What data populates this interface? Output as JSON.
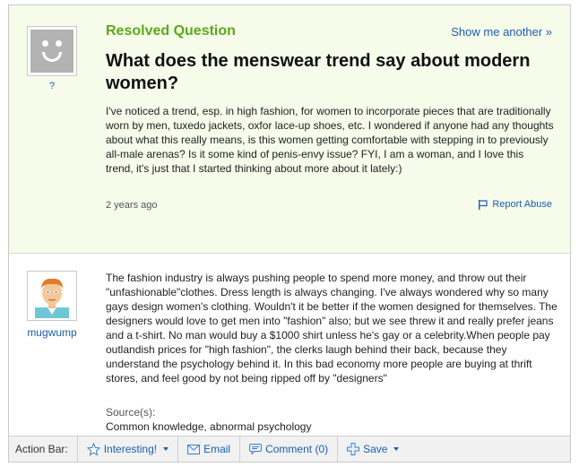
{
  "question": {
    "status": "Resolved Question",
    "show_another": "Show me another »",
    "asker_name": "?",
    "title": "What does the menswear trend say about modern women?",
    "body": "I've noticed a trend, esp. in high fashion, for women to incorporate pieces that are traditionally worn by men, tuxedo jackets, oxfor lace-up shoes, etc. I wondered if anyone had any thoughts about what this really means, is this women getting comfortable with stepping in to previously all-male arenas? Is it some kind of penis-envy issue? FYI, I am a woman, and I love this trend, it's just that I started thinking about more about it lately:)",
    "time": "2 years ago",
    "report": "Report Abuse"
  },
  "answer": {
    "username": "mugwump",
    "body": "The fashion industry is always pushing people to spend more money, and throw out their \"unfashionable\"clothes. Dress length is always changing. I've always wondered why so many gays design women's clothing. Wouldn't it be better if the women designed for themselves. The designers would love to get men into \"fashion\" also; but we see threw it and really prefer jeans and a t-shirt. No man would buy a $1000 shirt unless he's gay or a celebrity.When people pay outlandish prices for \"high fashion\", the clerks laugh behind their back, because they understand the psychology behind it. In this bad economy more people are buying at thrift stores, and feel good by not being ripped off by \"designers\"",
    "source_label": "Source(s):",
    "source_text": "Common knowledge, abnormal psychology"
  },
  "action_bar": {
    "label": "Action Bar:",
    "interesting": "Interesting!",
    "email": "Email",
    "comment": "Comment (0)",
    "save": "Save"
  },
  "colors": {
    "resolved_green": "#5aa91b",
    "link_blue": "#1a5faf",
    "question_bg": "#f6fbea"
  }
}
